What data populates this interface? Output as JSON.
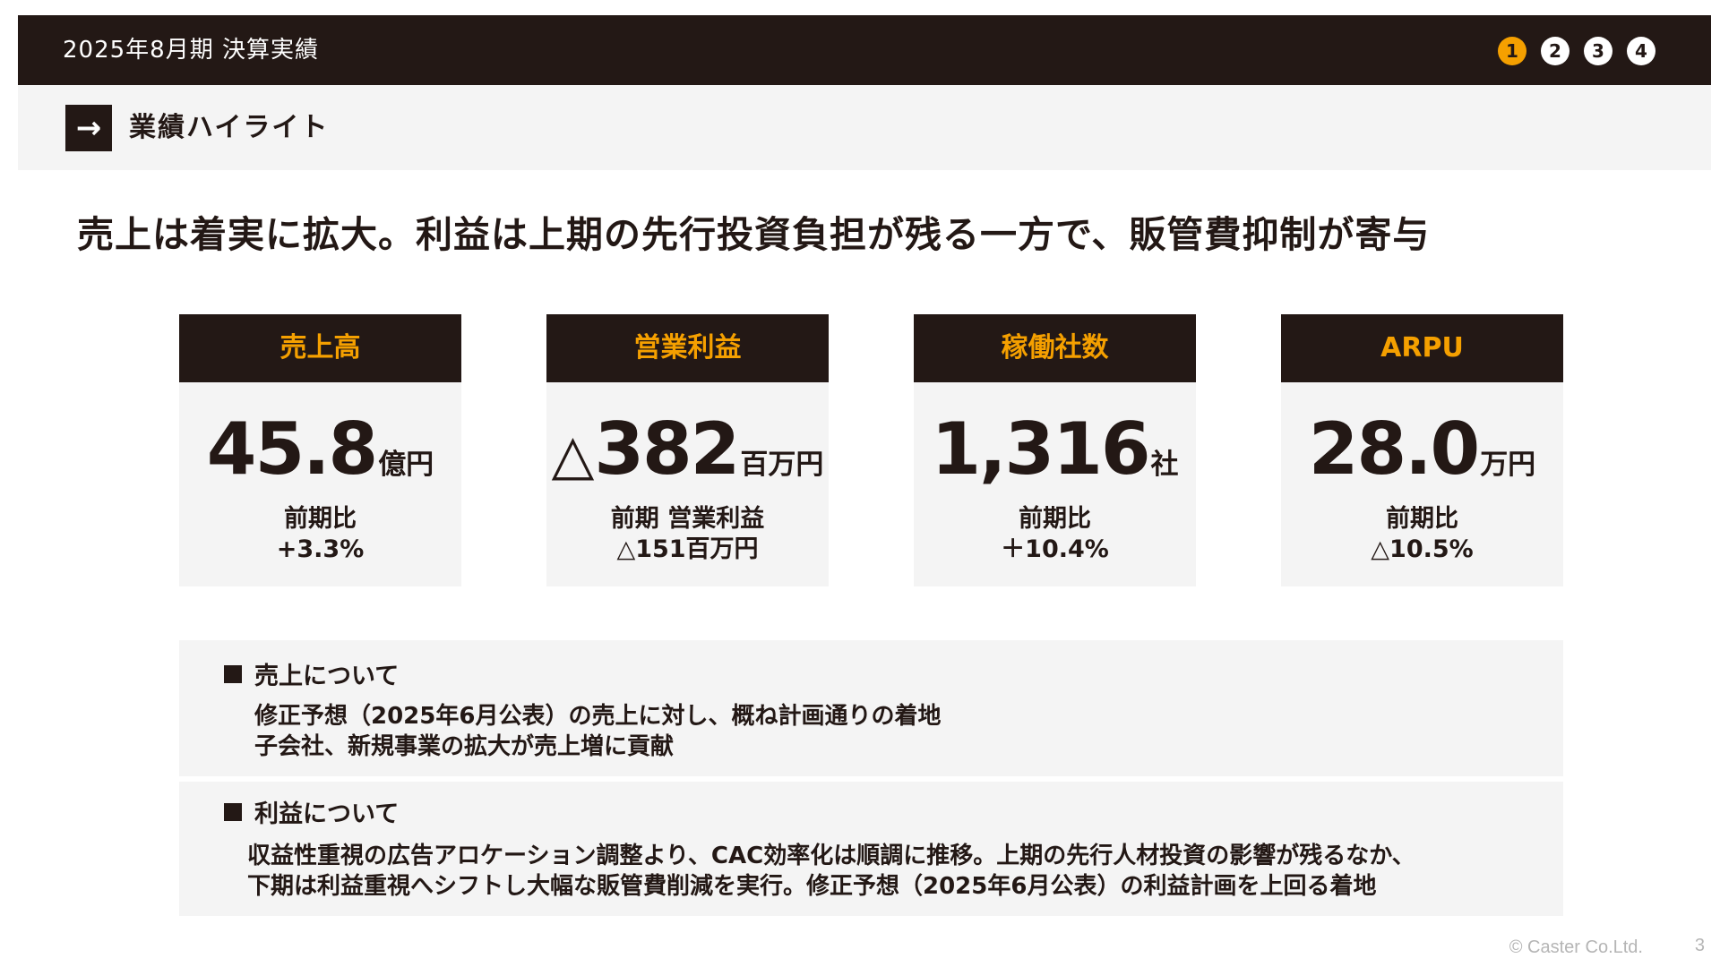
{
  "header": {
    "title": "2025年8月期 決算実績",
    "pages": [
      "1",
      "2",
      "3",
      "4"
    ],
    "active_page": "1",
    "accent_color": "#f5a000",
    "dark_color": "#231815"
  },
  "section": {
    "icon": "arrow-right-icon",
    "title": "業績ハイライト"
  },
  "headline": "売上は着実に拡大。利益は上期の先行投資負担が残る一方で、販管費抑制が寄与",
  "kpis": [
    {
      "label": "売上高",
      "prefix": "",
      "value": "45.8",
      "unit": "億円",
      "comp_label": "前期比",
      "comp_value": "+3.3%"
    },
    {
      "label": "営業利益",
      "prefix": "△",
      "value": "382",
      "unit": "百万円",
      "comp_label": "前期 営業利益",
      "comp_value": "△151百万円"
    },
    {
      "label": "稼働社数",
      "prefix": "",
      "value": "1,316",
      "unit": "社",
      "comp_label": "前期比",
      "comp_value": "＋10.4%"
    },
    {
      "label": "ARPU",
      "prefix": "",
      "value": "28.0",
      "unit": "万円",
      "comp_label": "前期比",
      "comp_value": "△10.5%"
    }
  ],
  "notes": {
    "sales": {
      "title": "売上について",
      "lines": [
        "修正予想（2025年6月公表）の売上に対し、概ね計画通りの着地",
        "子会社、新規事業の拡大が売上増に貢献"
      ]
    },
    "profit": {
      "title": "利益について",
      "lines": [
        "収益性重視の広告アロケーション調整より、CAC効率化は順調に推移。上期の先行人材投資の影響が残るなか、",
        "下期は利益重視へシフトし大幅な販管費削減を実行。修正予想（2025年6月公表）の利益計画を上回る着地"
      ]
    }
  },
  "footer": {
    "copyright": "© Caster Co.Ltd.",
    "page_number": "3"
  }
}
